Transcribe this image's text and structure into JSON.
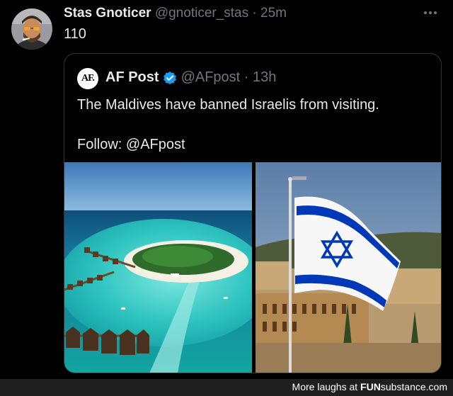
{
  "tweet": {
    "author_name": "Stas Gnoticer",
    "handle_time": "@gnoticer_stas · 25m",
    "text": "110"
  },
  "quoted_tweet": {
    "logo_text": "AF.",
    "author_name": "AF Post",
    "handle_time": "@AFpost · 13h",
    "text": "The Maldives have banned Israelis from visiting.",
    "follow": "Follow: @AFpost"
  },
  "footer": {
    "prefix": "More laughs at",
    "brand_bold": "FUN",
    "brand_rest": "substance.com"
  },
  "colors": {
    "background": "#000000",
    "muted": "#71767b",
    "verified": "#1d9bf0",
    "israel_blue": "#0038b8"
  }
}
